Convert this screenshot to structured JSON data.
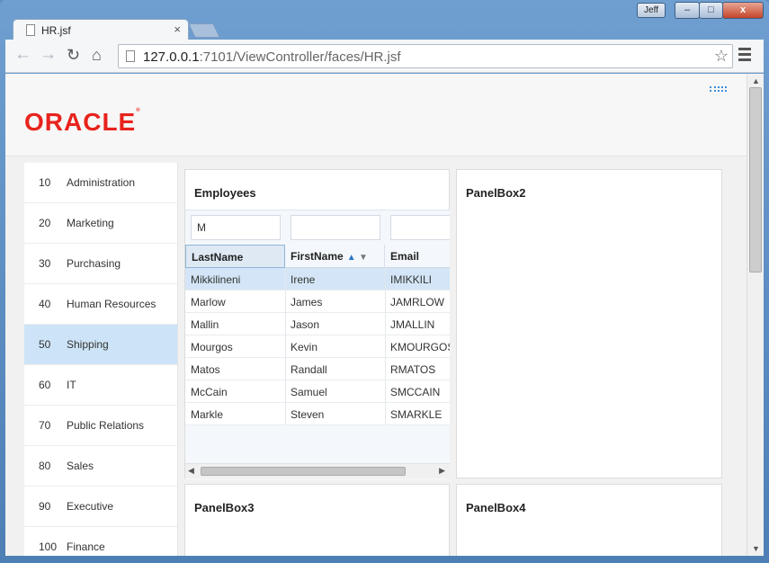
{
  "window": {
    "user": "Jeff",
    "minimize": "–",
    "maximize": "□",
    "close": "x"
  },
  "tab": {
    "title": "HR.jsf",
    "close": "×"
  },
  "toolbar": {
    "url_host": "127.0.0.1",
    "url_rest": ":7101/ViewController/faces/HR.jsf"
  },
  "header": {
    "logo": "ORACLE"
  },
  "departments": [
    {
      "id": "10",
      "name": "Administration"
    },
    {
      "id": "20",
      "name": "Marketing"
    },
    {
      "id": "30",
      "name": "Purchasing"
    },
    {
      "id": "40",
      "name": "Human Resources"
    },
    {
      "id": "50",
      "name": "Shipping",
      "selected": true
    },
    {
      "id": "60",
      "name": "IT"
    },
    {
      "id": "70",
      "name": "Public Relations"
    },
    {
      "id": "80",
      "name": "Sales"
    },
    {
      "id": "90",
      "name": "Executive"
    },
    {
      "id": "100",
      "name": "Finance"
    }
  ],
  "panels": {
    "p1": {
      "title": "Employees"
    },
    "p2": {
      "title": "PanelBox2"
    },
    "p3": {
      "title": "PanelBox3"
    },
    "p4": {
      "title": "PanelBox4"
    }
  },
  "employees": {
    "filters": {
      "last_name": "M",
      "first_name": "",
      "email": ""
    },
    "columns": {
      "last_name": "LastName",
      "first_name": "FirstName",
      "email": "Email"
    },
    "rows": [
      {
        "last": "Mikkilineni",
        "first": "Irene",
        "email": "IMIKKILI",
        "selected": true
      },
      {
        "last": "Marlow",
        "first": "James",
        "email": "JAMRLOW"
      },
      {
        "last": "Mallin",
        "first": "Jason",
        "email": "JMALLIN"
      },
      {
        "last": "Mourgos",
        "first": "Kevin",
        "email": "KMOURGOS"
      },
      {
        "last": "Matos",
        "first": "Randall",
        "email": "RMATOS"
      },
      {
        "last": "McCain",
        "first": "Samuel",
        "email": "SMCCAIN"
      },
      {
        "last": "Markle",
        "first": "Steven",
        "email": "SMARKLE"
      }
    ]
  }
}
